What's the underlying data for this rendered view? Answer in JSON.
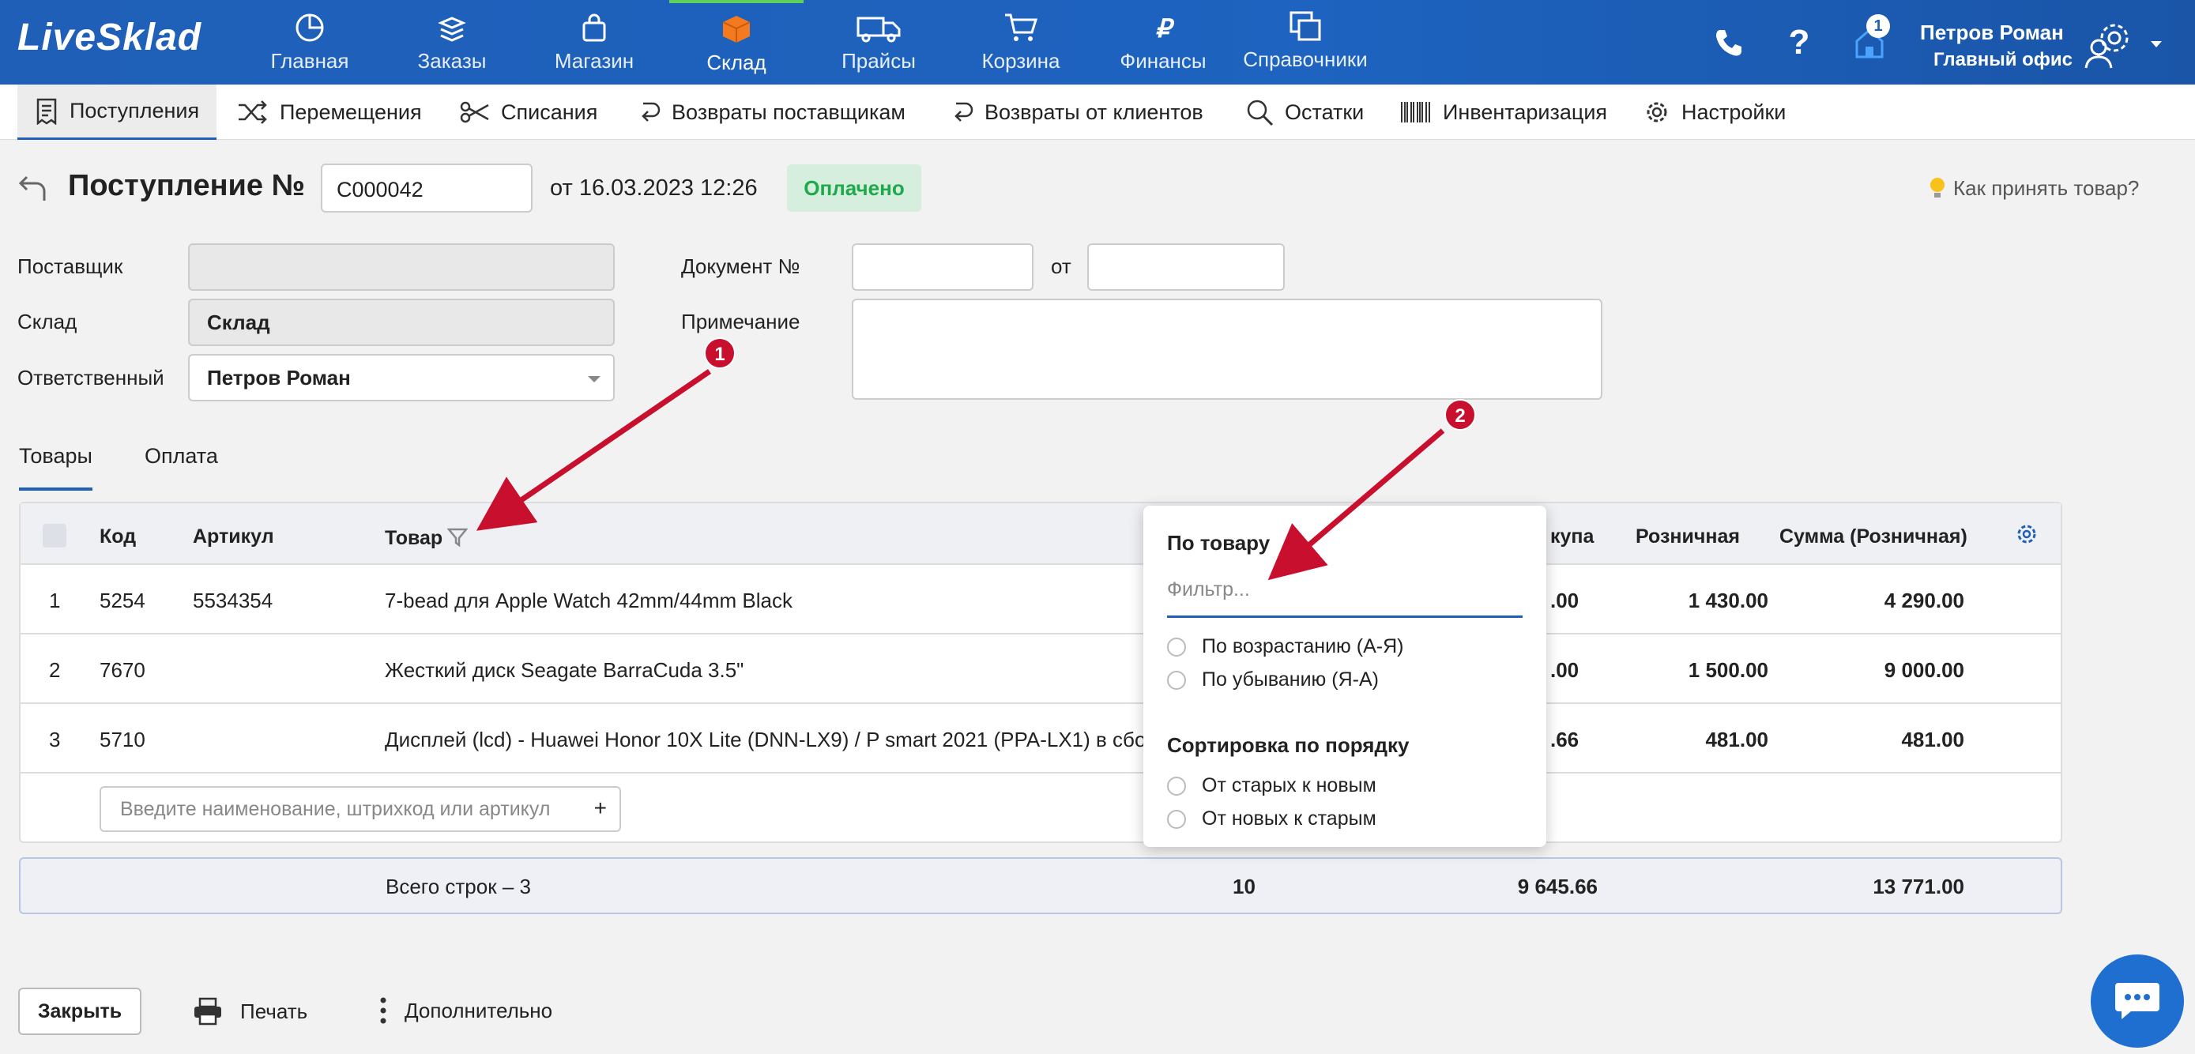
{
  "app": {
    "logo": "LiveSklad"
  },
  "topnav": [
    {
      "label": "Главная",
      "icon": "pie-chart-icon"
    },
    {
      "label": "Заказы",
      "icon": "stack-icon"
    },
    {
      "label": "Магазин",
      "icon": "bag-icon"
    },
    {
      "label": "Склад",
      "icon": "box-icon",
      "active": true
    },
    {
      "label": "Прайсы",
      "icon": "truck-icon"
    },
    {
      "label": "Корзина",
      "icon": "cart-icon"
    },
    {
      "label": "Финансы",
      "icon": "ruble-icon"
    },
    {
      "label": "Справочники",
      "icon": "copy-icon"
    }
  ],
  "user": {
    "name": "Петров Роман",
    "office": "Главный офис",
    "notifications": "1"
  },
  "subnav": [
    {
      "label": "Поступления",
      "active": true
    },
    {
      "label": "Перемещения"
    },
    {
      "label": "Списания"
    },
    {
      "label": "Возвраты поставщикам"
    },
    {
      "label": "Возвраты от клиентов"
    },
    {
      "label": "Остатки"
    },
    {
      "label": "Инвентаризация"
    },
    {
      "label": "Настройки"
    }
  ],
  "doc": {
    "title": "Поступление №",
    "number": "С000042",
    "date": "от 16.03.2023 12:26",
    "status": "Оплачено",
    "help": "Как принять товар?"
  },
  "form": {
    "supplier_label": "Поставщик",
    "supplier_value": "",
    "warehouse_label": "Склад",
    "warehouse_value": "Склад",
    "responsible_label": "Ответственный",
    "responsible_value": "Петров Роман",
    "docnum_label": "Документ №",
    "docnum_value": "",
    "from_label": "от",
    "from_value": "",
    "note_label": "Примечание",
    "note_value": ""
  },
  "tabs": [
    {
      "label": "Товары",
      "active": true
    },
    {
      "label": "Оплата"
    }
  ],
  "table": {
    "headers": {
      "code": "Код",
      "article": "Артикул",
      "product": "Товар",
      "purchase": "купа",
      "retail": "Розничная",
      "retail_sum": "Сумма (Розничная)"
    },
    "rows": [
      {
        "n": "1",
        "code": "5254",
        "article": "5534354",
        "product": "7-bead для Apple Watch 42mm/44mm Black",
        "purchase": ".00",
        "retail": "1 430.00",
        "retail_sum": "4 290.00"
      },
      {
        "n": "2",
        "code": "7670",
        "article": "",
        "product": "Жесткий диск Seagate BarraCuda 3.5\"",
        "purchase": ".00",
        "retail": "1 500.00",
        "retail_sum": "9 000.00"
      },
      {
        "n": "3",
        "code": "5710",
        "article": "",
        "product": "Дисплей (lcd) - Huawei Honor 10X Lite (DNN-LX9) / P smart 2021 (PPA-LX1) в сбор...",
        "purchase": ".66",
        "retail": "481.00",
        "retail_sum": "481.00"
      }
    ],
    "add_placeholder": "Введите наименование, штрихкод или артикул",
    "add_plus": "+"
  },
  "total": {
    "label": "Всего строк – 3",
    "qty": "10",
    "purchase_sum": "9 645.66",
    "retail_sum": "13 771.00"
  },
  "popup": {
    "title": "По товару",
    "filter_placeholder": "Фильтр...",
    "asc": "По возрастанию (А-Я)",
    "desc": "По убыванию (Я-А)",
    "order_title": "Сортировка по порядку",
    "old_new": "От старых к новым",
    "new_old": "От новых к старым"
  },
  "markers": [
    "1",
    "2"
  ],
  "footer": {
    "close": "Закрыть",
    "print": "Печать",
    "more": "Дополнительно"
  },
  "colors": {
    "brand": "#1f5fb8",
    "paid_bg": "#d6eedd",
    "paid_text": "#1fa94d",
    "arrow": "#c8102e"
  }
}
